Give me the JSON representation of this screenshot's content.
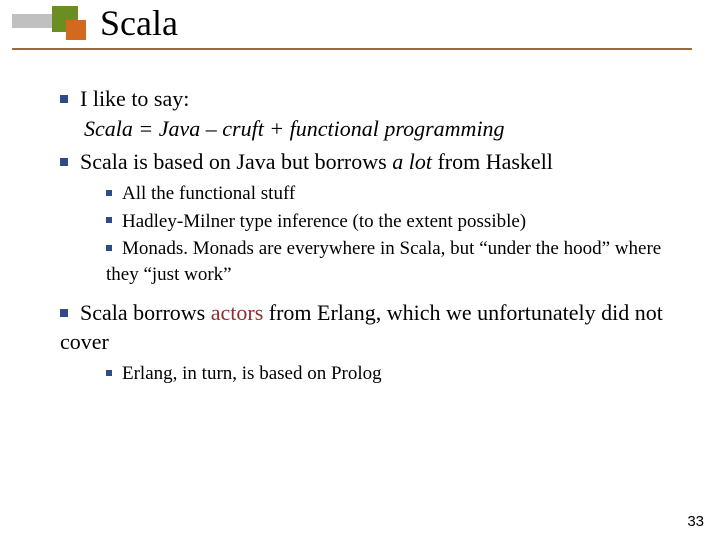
{
  "title": "Scala",
  "bullets": {
    "b1a": "I like to say:",
    "b1a_italic": "Scala = Java – cruft + functional programming",
    "b1b_pre": "Scala is based on Java but borrows ",
    "b1b_em": "a lot",
    "b1b_post": " from Haskell",
    "b2a": "All the functional stuff",
    "b2b": "Hadley-Milner type inference (to the extent possible)",
    "b2c": "Monads. Monads are everywhere in Scala, but “under the hood” where they “just work”",
    "b1c_pre": "Scala borrows ",
    "b1c_red": "actors",
    "b1c_post": " from Erlang, which we unfortunately did not cover",
    "b3a": "Erlang, in turn, is based on Prolog"
  },
  "page_number": "33"
}
